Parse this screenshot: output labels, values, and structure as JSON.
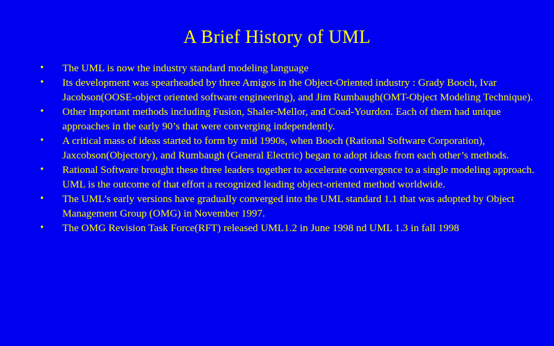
{
  "slide": {
    "title": "A Brief History of UML",
    "bullet_symbol": "•",
    "bullets": [
      "The UML is now the industry standard modeling language",
      "Its development was spearheaded by three Amigos in the Object-Oriented industry : Grady Booch, Ivar Jacobson(OOSE-object oriented software engineering), and Jim Rumbaugh(OMT-Object Modeling Technique).",
      "Other important methods including Fusion, Shaler-Mellor, and Coad-Yourdon. Each of them had unique approaches in the early 90’s that were converging independently.",
      "A critical mass of ideas started to form by mid 1990s, when Booch (Rational Software Corporation), Jaxcobson(Objectory), and Rumbaugh (General Electric) began to adopt ideas from each other’s methods.",
      "Rational Software brought these three leaders together to accelerate convergence to a single modeling approach. UML is the outcome of that effort a recognized leading object-oriented method worldwide.",
      "The UML’s early versions have gradually converged into the UML standard 1.1 that was adopted by Object Management Group (OMG) in November 1997.",
      "The OMG Revision Task Force(RFT) released UML1.2 in June 1998 nd UML 1.3 in fall 1998"
    ]
  },
  "colors": {
    "background": "#0000f0",
    "text": "#ffff00"
  }
}
